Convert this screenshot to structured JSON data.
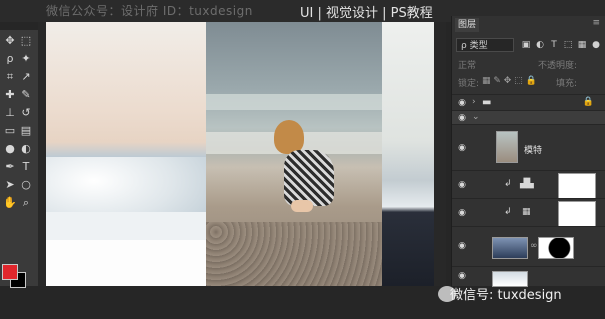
{
  "watermark_top": "微信公众号：设计府 ID：tuxdesign",
  "top_links": "UI | 视觉设计 | PS教程",
  "tools": {
    "icons": [
      "move-tool-icon",
      "marquee-tool-icon",
      "lasso-tool-icon",
      "magic-wand-icon",
      "crop-tool-icon",
      "eyedropper-icon",
      "healing-brush-icon",
      "brush-tool-icon",
      "clone-stamp-icon",
      "history-brush-icon",
      "eraser-icon",
      "gradient-tool-icon",
      "blur-tool-icon",
      "dodge-tool-icon",
      "pen-tool-icon",
      "type-tool-icon",
      "path-select-icon",
      "shape-tool-icon",
      "hand-tool-icon",
      "zoom-tool-icon"
    ],
    "foreground_color": "#e0262c",
    "background_color": "#000000"
  },
  "layers_panel": {
    "tab_label": "图层",
    "filter_label": "ρ 类型",
    "blend_mode": "正常",
    "opacity_label": "不透明度:",
    "lock_label": "锁定:",
    "fill_label": "填充:",
    "layers": [
      {
        "name": "",
        "kind": "group"
      },
      {
        "name": "",
        "kind": "group-open"
      },
      {
        "name": "模特",
        "kind": "smart-object"
      },
      {
        "name": "",
        "kind": "adjustment-levels"
      },
      {
        "name": "",
        "kind": "adjustment-curves"
      },
      {
        "name": "",
        "kind": "image-with-mask"
      },
      {
        "name": "",
        "kind": "image"
      }
    ]
  },
  "watermark_bottom": "微信号: tuxdesign"
}
